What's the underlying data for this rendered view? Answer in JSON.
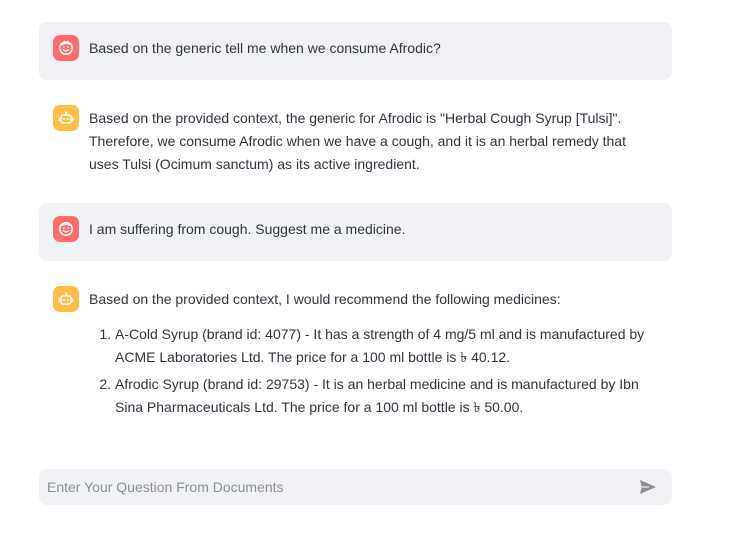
{
  "chat": {
    "messages": [
      {
        "role": "user",
        "avatar_icon": "smiley-face-icon",
        "text": "Based on the generic tell me when we consume Afrodic?"
      },
      {
        "role": "assistant",
        "avatar_icon": "robot-icon",
        "text": "Based on the provided context, the generic for Afrodic is \"Herbal Cough Syrup [Tulsi]\". Therefore, we consume Afrodic when we have a cough, and it is an herbal remedy that uses Tulsi (Ocimum sanctum) as its active ingredient."
      },
      {
        "role": "user",
        "avatar_icon": "smiley-face-icon",
        "text": "I am suffering from cough. Suggest me a medicine."
      },
      {
        "role": "assistant",
        "avatar_icon": "robot-icon",
        "text": "Based on the provided context, I would recommend the following medicines:",
        "list": [
          "A-Cold Syrup (brand id: 4077) - It has a strength of 4 mg/5 ml and is manufactured by ACME Laboratories Ltd. The price for a 100 ml bottle is ৳ 40.12.",
          "Afrodic Syrup (brand id: 29753) - It is an herbal medicine and is manufactured by Ibn Sina Pharmaceuticals Ltd. The price for a 100 ml bottle is ৳ 50.00."
        ]
      }
    ]
  },
  "input": {
    "placeholder": "Enter Your Question From Documents",
    "value": "",
    "send_icon": "send-icon"
  },
  "colors": {
    "user_avatar": "#ff6c6c",
    "assistant_avatar": "#ffbd45",
    "user_bubble": "#f0f2f6",
    "text": "#31333f"
  }
}
